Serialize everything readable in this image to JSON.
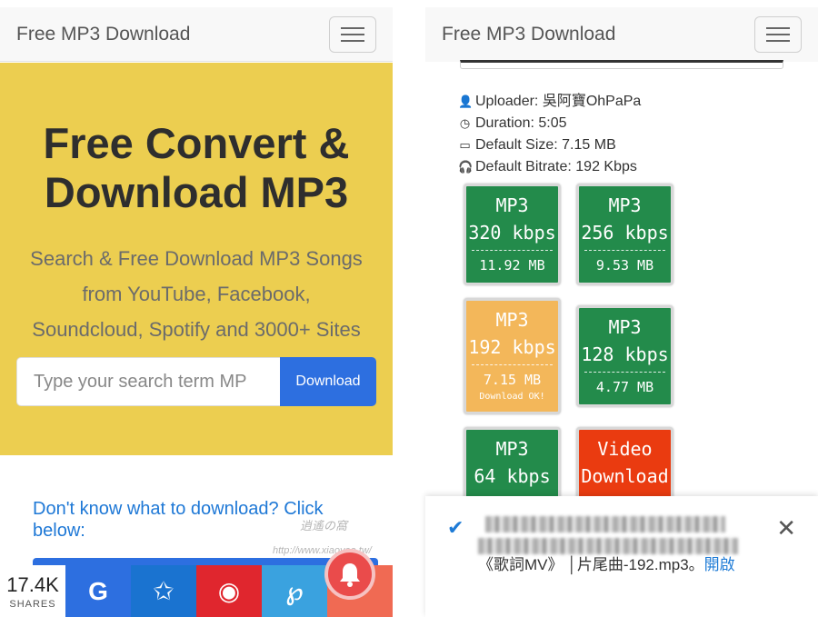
{
  "left": {
    "brand": "Free MP3 Download",
    "hero": {
      "title_line1": "Free Convert &",
      "title_line2": "Download MP3",
      "sub_line1": "Search & Free Download MP3 Songs",
      "sub_line2": "from YouTube, Facebook,",
      "sub_line3": "Soundcloud, Spotify and 3000+ Sites",
      "search_placeholder": "Type your search term MP",
      "download_label": "Download"
    },
    "cta_line1": "Don't know what to download? Click",
    "cta_line2": "below:",
    "share": {
      "count": "17.4K",
      "label": "SHARES",
      "buttons": [
        {
          "icon": "google-icon",
          "glyph": "G",
          "color": "#2d6fe0"
        },
        {
          "icon": "star-bookmark-icon",
          "glyph": "✩",
          "color": "#1a73d0"
        },
        {
          "icon": "weibo-icon",
          "glyph": "◉",
          "color": "#e0262e"
        },
        {
          "icon": "pin-icon",
          "glyph": "℘",
          "color": "#3aa2df"
        },
        {
          "icon": "more-icon",
          "glyph": "",
          "color": "#f06a53"
        }
      ]
    },
    "watermark": "逍遙の窩",
    "watermark_url": "http://www.xiaoyao.tw/"
  },
  "right": {
    "brand": "Free MP3 Download",
    "info": {
      "uploader": "Uploader: 吳阿寶OhPaPa",
      "duration": "Duration: 5:05",
      "size": "Default Size: 7.15 MB",
      "bitrate": "Default Bitrate: 192 Kbps"
    },
    "formats": [
      {
        "line1": "MP3",
        "line2": "320 kbps",
        "size": "11.92 MB",
        "note": "",
        "color": "#238b4b"
      },
      {
        "line1": "MP3",
        "line2": "256 kbps",
        "size": "9.53 MB",
        "note": "",
        "color": "#238b4b"
      },
      {
        "line1": "MP3",
        "line2": "192 kbps",
        "size": "7.15 MB",
        "note": "Download OK!",
        "color": "#f3b75a"
      },
      {
        "line1": "MP3",
        "line2": "128 kbps",
        "size": "4.77 MB",
        "note": "",
        "color": "#238b4b"
      },
      {
        "line1": "MP3",
        "line2": "64 kbps",
        "size": "",
        "note": "",
        "color": "#238b4b"
      },
      {
        "line1": "Video",
        "line2": "Download",
        "size": "",
        "note": "",
        "color": "#ea3b10"
      }
    ],
    "toast": {
      "text": "《歌詞MV》 │片尾曲-192.mp3。",
      "link": "開啟"
    }
  }
}
